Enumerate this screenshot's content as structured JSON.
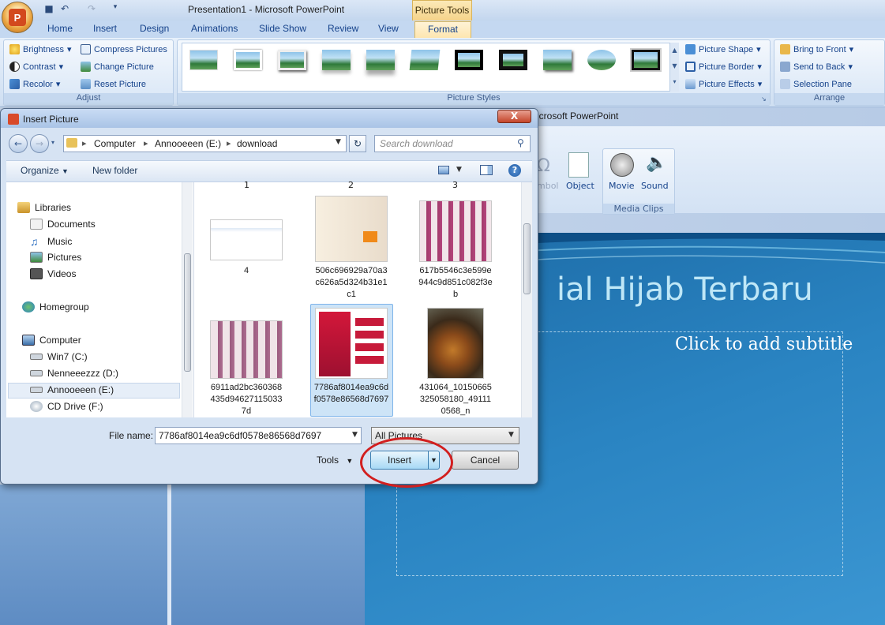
{
  "window": {
    "title": "Presentation1 - Microsoft PowerPoint",
    "context_tab": "Picture Tools"
  },
  "tabs": [
    "Home",
    "Insert",
    "Design",
    "Animations",
    "Slide Show",
    "Review",
    "View",
    "Format"
  ],
  "ribbon": {
    "adjust": {
      "label": "Adjust",
      "brightness": "Brightness",
      "contrast": "Contrast",
      "recolor": "Recolor",
      "compress": "Compress Pictures",
      "change": "Change Picture",
      "reset": "Reset Picture"
    },
    "picture_styles": {
      "label": "Picture Styles",
      "shape": "Picture Shape",
      "border": "Picture Border",
      "effects": "Picture Effects"
    },
    "arrange": {
      "label": "Arrange",
      "bring_front": "Bring to Front",
      "send_back": "Send to Back",
      "selection_pane": "Selection Pane"
    }
  },
  "background": {
    "title_fragment": "icrosoft PowerPoint",
    "symbol": "mbol",
    "object": "Object",
    "movie": "Movie",
    "sound": "Sound",
    "media_clips": "Media Clips",
    "slide_title": "ial Hijab Terbaru",
    "subtitle_placeholder": "Click to add subtitle"
  },
  "dialog": {
    "title": "Insert Picture",
    "close": "X",
    "breadcrumb": [
      "Computer",
      "Annooeeen (E:)",
      "download"
    ],
    "search_placeholder": "Search download",
    "organize": "Organize",
    "new_folder": "New folder",
    "nav": {
      "libraries": "Libraries",
      "documents": "Documents",
      "music": "Music",
      "pictures": "Pictures",
      "videos": "Videos",
      "homegroup": "Homegroup",
      "computer": "Computer",
      "drive_c": "Win7 (C:)",
      "drive_d": "Nenneeezzz (D:)",
      "drive_e": "Annooeeen (E:)",
      "drive_f": "CD Drive (F:)"
    },
    "files": {
      "top1": "1",
      "top2": "2",
      "top3": "3",
      "f4": "4",
      "f5": "506c696929a70a3c626a5d324b31e1c1",
      "f6": "617b5546c3e599e944c9d851c082f3eb",
      "f7": "6911ad2bc360368435d946271150337d",
      "f8": "7786af8014ea9c6df0578e86568d7697",
      "f9": "431064_10150665325058180_491110568_n"
    },
    "file_name_label": "File name:",
    "file_name_value": "7786af8014ea9c6df0578e86568d7697",
    "filter": "All Pictures",
    "tools": "Tools",
    "insert": "Insert",
    "cancel": "Cancel"
  }
}
